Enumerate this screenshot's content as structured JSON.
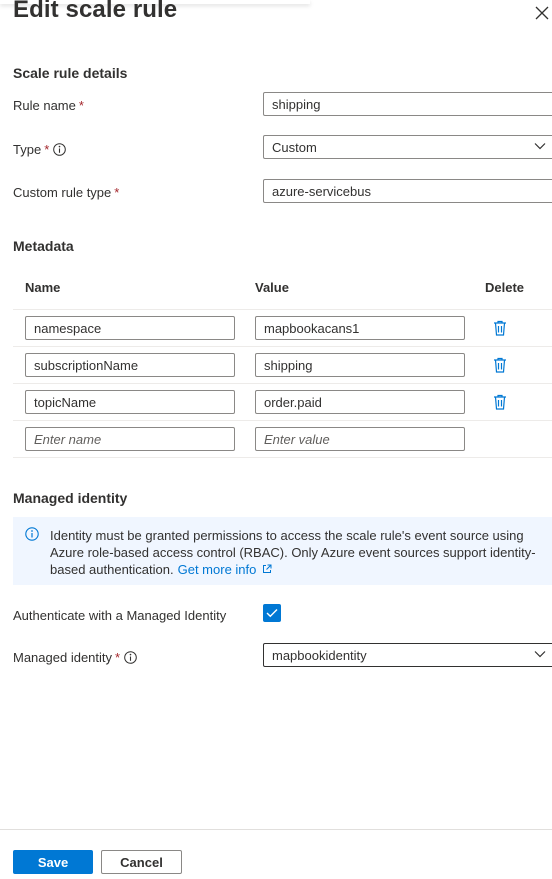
{
  "panel": {
    "title": "Edit scale rule",
    "close_icon": "close-icon"
  },
  "details": {
    "heading": "Scale rule details",
    "rule_name": {
      "label": "Rule name",
      "value": "shipping"
    },
    "type": {
      "label": "Type",
      "value": "Custom"
    },
    "custom_rule_type": {
      "label": "Custom rule type",
      "value": "azure-servicebus"
    }
  },
  "metadata": {
    "heading": "Metadata",
    "columns": [
      "Name",
      "Value",
      "Delete"
    ],
    "rows": [
      {
        "name": "namespace",
        "value": "mapbookacans1"
      },
      {
        "name": "subscriptionName",
        "value": "shipping"
      },
      {
        "name": "topicName",
        "value": "order.paid"
      }
    ],
    "new_row": {
      "name_placeholder": "Enter name",
      "value_placeholder": "Enter value"
    }
  },
  "identity": {
    "heading": "Managed identity",
    "info_text": "Identity must be granted permissions to access the scale rule's event source using Azure role-based access control (RBAC). Only Azure event sources support identity-based authentication.",
    "info_link": "Get more info",
    "auth_label": "Authenticate with a Managed Identity",
    "auth_checked": true,
    "identity_label": "Managed identity",
    "identity_value": "mapbookidentity"
  },
  "footer": {
    "save_label": "Save",
    "cancel_label": "Cancel"
  },
  "colors": {
    "accent": "#0078d4",
    "required": "#a4262c",
    "info_bg": "#f0f6ff"
  }
}
